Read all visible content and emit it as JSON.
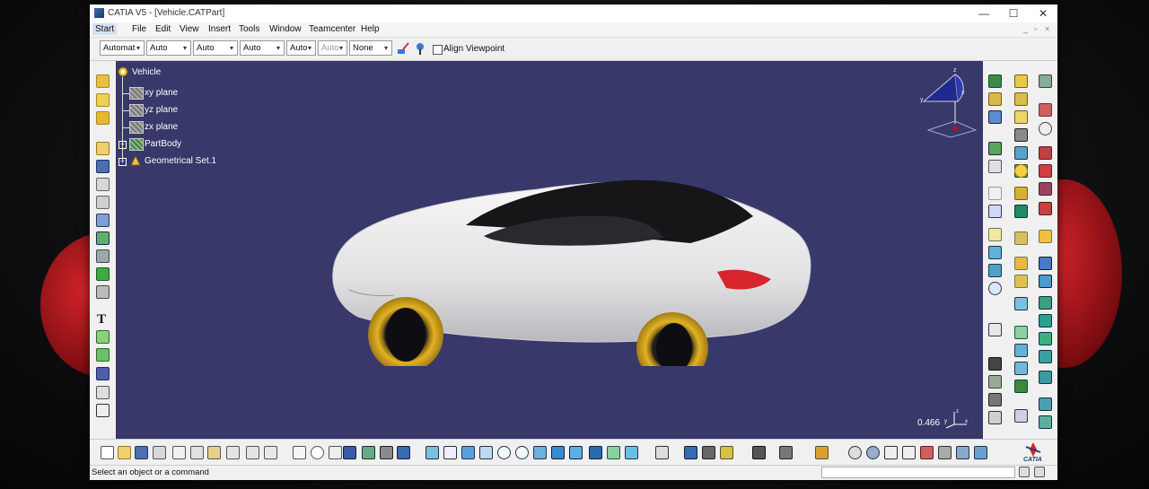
{
  "window": {
    "title": "CATIA V5 - [Vehicle.CATPart]",
    "controls": {
      "minimize": "—",
      "maximize": "☐",
      "close": "✕"
    }
  },
  "menu": {
    "items": [
      "Start",
      "File",
      "Edit",
      "View",
      "Insert",
      "Tools",
      "Window",
      "Teamcenter",
      "Help"
    ]
  },
  "toolbar": {
    "combos": [
      "Automat",
      "Auto",
      "Auto",
      "Auto",
      "Auto",
      "Auto",
      "None"
    ],
    "align_viewpoint_label": "Align Viewpoint",
    "align_viewpoint_checked": false
  },
  "tree": {
    "root": "Vehicle",
    "items": [
      "xy plane",
      "yz plane",
      "zx plane",
      "PartBody",
      "Geometrical Set.1"
    ]
  },
  "viewport": {
    "background_color": "#38386a",
    "zoom_value": "0.466",
    "compass_axes": [
      "x",
      "y",
      "z"
    ]
  },
  "statusbar": {
    "message": "Select an object or a command",
    "command_input": ""
  },
  "branding": {
    "logo": "CATIA"
  },
  "colors": {
    "body": "#e9e9ea",
    "roof": "#1a1a1a",
    "wheel": "#d4a017",
    "taillight": "#d6262b"
  }
}
